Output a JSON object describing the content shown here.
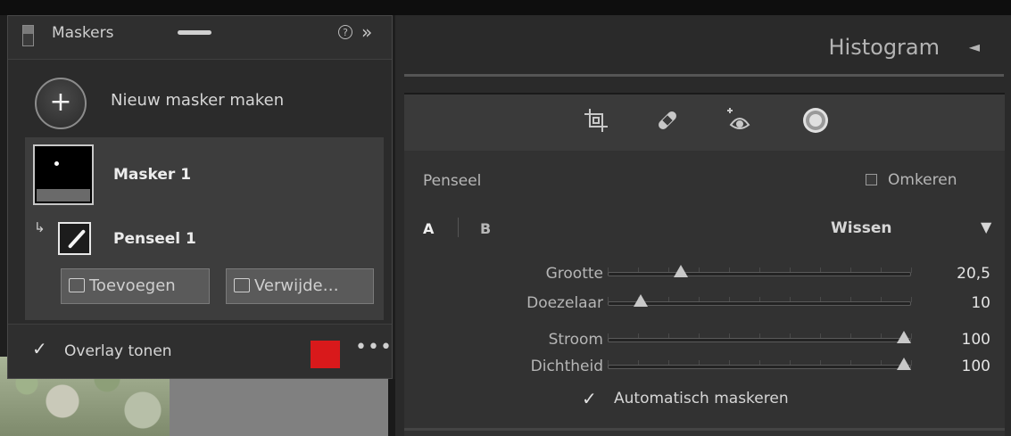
{
  "masks_panel": {
    "title": "Maskers",
    "help_glyph": "?",
    "collapse_glyph": "»",
    "new_mask": {
      "plus_glyph": "+",
      "label": "Nieuw masker maken"
    },
    "items": [
      {
        "label": "Masker 1",
        "sub_items": [
          {
            "label": "Penseel 1"
          }
        ]
      }
    ],
    "sub_arrow_glyph": "↳",
    "add_button": "Toevoegen",
    "delete_button": "Verwijde…",
    "overlay": {
      "check_glyph": "✓",
      "label": "Overlay tonen",
      "color": "#d9191b",
      "more_glyph": "•••"
    }
  },
  "right_panel": {
    "histogram_title": "Histogram",
    "histogram_arrow": "◄",
    "tools": [
      "crop-icon",
      "healing-icon",
      "red-eye-icon",
      "mask-icon"
    ],
    "brush": {
      "section_label": "Penseel",
      "invert_label": "Omkeren",
      "tab_a": "A",
      "tab_b": "B",
      "erase_label": "Wissen",
      "erase_arrow": "▼",
      "sliders": [
        {
          "label": "Grootte",
          "value": "20,5",
          "fraction": 0.24
        },
        {
          "label": "Doezelaar",
          "value": "10",
          "fraction": 0.11
        },
        {
          "label": "Stroom",
          "value": "100",
          "fraction": 1.0
        },
        {
          "label": "Dichtheid",
          "value": "100",
          "fraction": 1.0
        }
      ],
      "auto_mask_glyph": "✓",
      "auto_mask_label": "Automatisch maskeren"
    }
  },
  "colors": {
    "accent_red": "#d9191b",
    "panel_bg": "#2b2b2b"
  }
}
